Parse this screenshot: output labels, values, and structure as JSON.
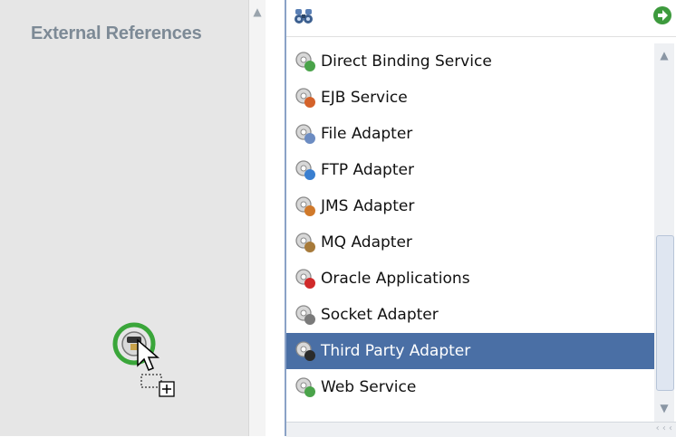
{
  "lane": {
    "title": "External References"
  },
  "palette": {
    "items": [
      {
        "label": "Direct Binding Service",
        "icon": "direct-binding-icon",
        "selected": false
      },
      {
        "label": "EJB Service",
        "icon": "ejb-service-icon",
        "selected": false
      },
      {
        "label": "File Adapter",
        "icon": "file-adapter-icon",
        "selected": false
      },
      {
        "label": "FTP Adapter",
        "icon": "ftp-adapter-icon",
        "selected": false
      },
      {
        "label": "JMS Adapter",
        "icon": "jms-adapter-icon",
        "selected": false
      },
      {
        "label": "MQ Adapter",
        "icon": "mq-adapter-icon",
        "selected": false
      },
      {
        "label": "Oracle Applications",
        "icon": "oracle-applications-icon",
        "selected": false
      },
      {
        "label": "Socket Adapter",
        "icon": "socket-adapter-icon",
        "selected": false
      },
      {
        "label": "Third Party Adapter",
        "icon": "third-party-adapter-icon",
        "selected": true
      },
      {
        "label": "Web Service",
        "icon": "web-service-icon",
        "selected": false
      }
    ]
  },
  "colors": {
    "selection": "#4a6fa5",
    "lane_title": "#7d8a96",
    "lane_bg": "#e6e6e6"
  }
}
